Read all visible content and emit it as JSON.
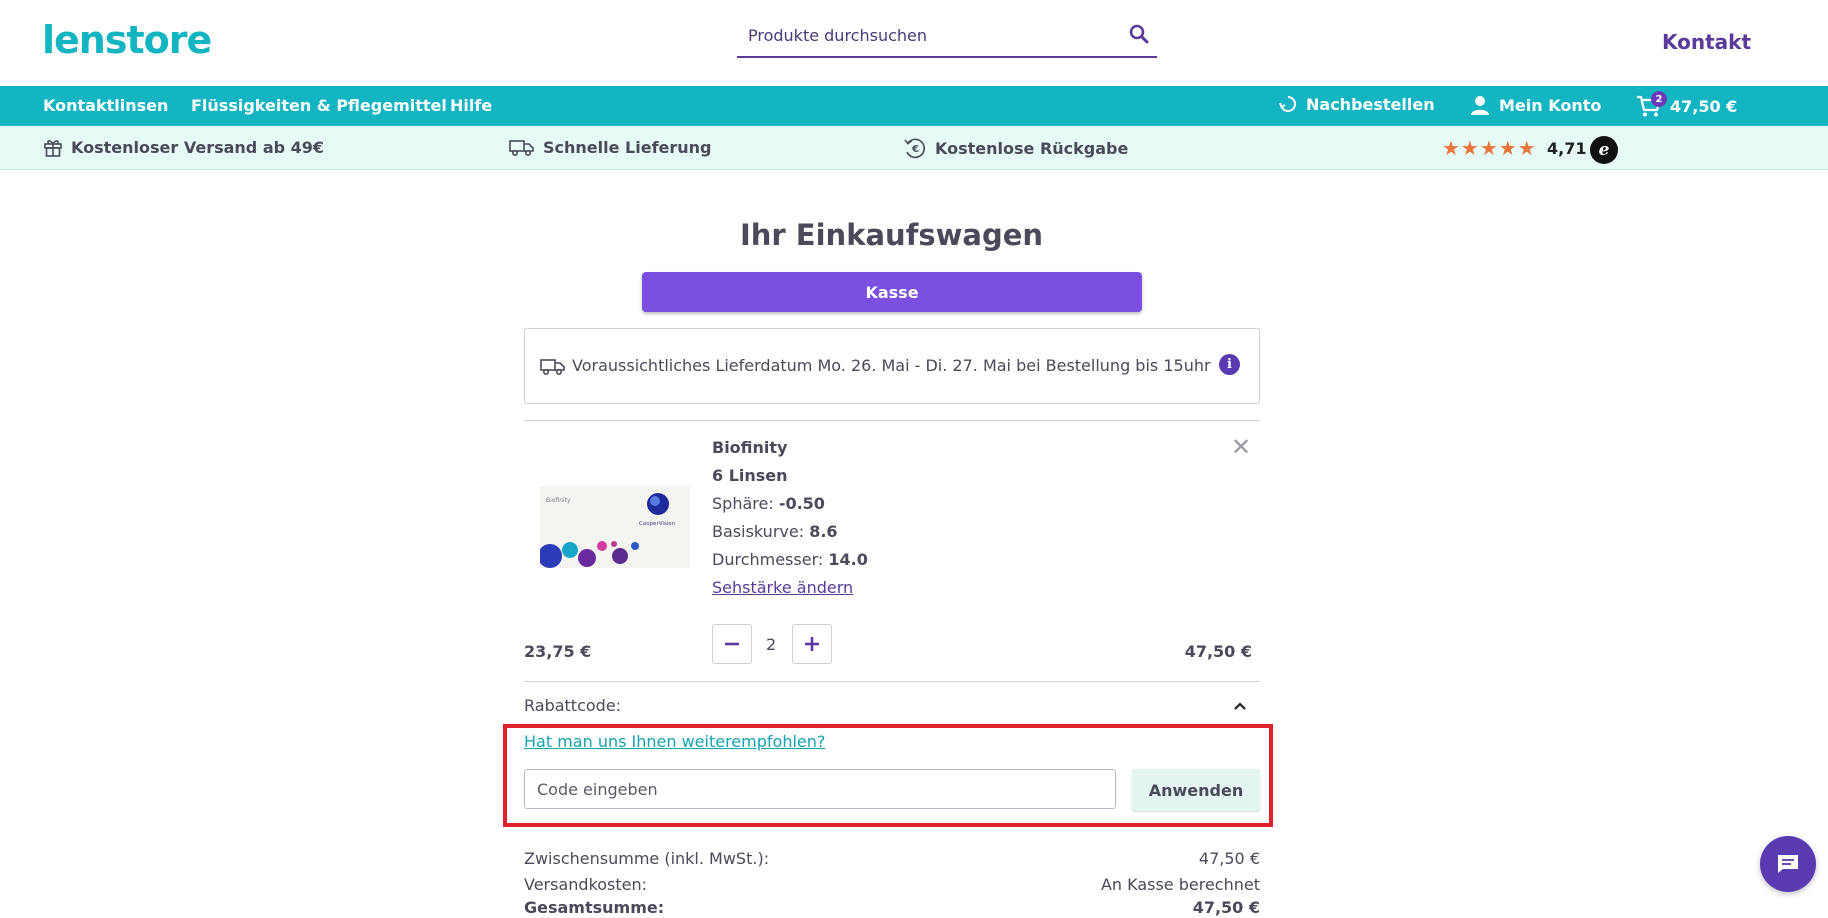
{
  "header": {
    "logo": "lenstore",
    "search_placeholder": "Produkte durchsuchen",
    "contact": "Kontakt"
  },
  "nav": {
    "items": [
      {
        "label": "Kontaktlinsen"
      },
      {
        "label": "Flüssigkeiten & Pflegemittel"
      },
      {
        "label": "Hilfe"
      }
    ],
    "reorder": "Nachbestellen",
    "account": "Mein Konto",
    "cart_count": "2",
    "cart_total": "47,50 €"
  },
  "usp": {
    "free_shipping": "Kostenloser Versand ab 49€",
    "fast_delivery": "Schnelle Lieferung",
    "free_returns": "Kostenlose Rückgabe",
    "stars": "★★★★★",
    "rating": "4,71",
    "trust_badge": "e"
  },
  "cart": {
    "title": "Ihr Einkaufswagen",
    "checkout_label": "Kasse",
    "delivery_text": "Voraussichtliches Lieferdatum Mo. 26. Mai - Di. 27. Mai bei Bestellung bis 15uhr",
    "product": {
      "name": "Biofinity",
      "pack": "6 Linsen",
      "sphere_label": "Sphäre:",
      "sphere_value": "-0.50",
      "base_curve_label": "Basiskurve:",
      "base_curve_value": "8.6",
      "diameter_label": "Durchmesser:",
      "diameter_value": "14.0",
      "change_link": "Sehstärke ändern",
      "unit_price": "23,75 €",
      "quantity": "2",
      "line_total": "47,50 €",
      "image_brand": "Biofinity",
      "image_maker": "CooperVision"
    },
    "discount": {
      "label": "Rabattcode:",
      "referral_link": "Hat man uns Ihnen weiterempfohlen?",
      "code_placeholder": "Code eingeben",
      "apply_label": "Anwenden"
    },
    "summary": {
      "subtotal_label": "Zwischensumme (inkl. MwSt.):",
      "subtotal_value": "47,50 €",
      "shipping_label": "Versandkosten:",
      "shipping_value": "An Kasse berechnet",
      "total_label": "Gesamtsumme:",
      "total_value": "47,50 €"
    }
  },
  "colors": {
    "teal": "#13b5c2",
    "purple": "#7b4fe0",
    "highlight": "#e0212b"
  }
}
